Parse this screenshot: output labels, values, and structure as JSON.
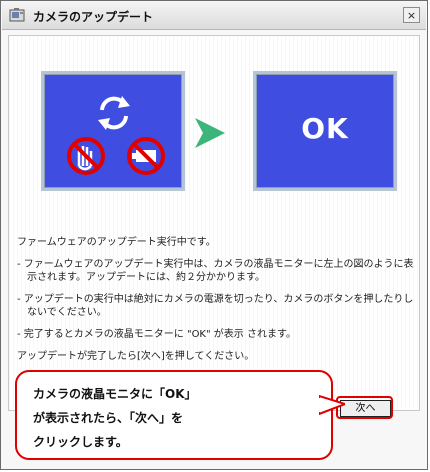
{
  "window": {
    "title": "カメラのアップデート",
    "close_label": "×"
  },
  "illustration": {
    "left_panel_icons": [
      "refresh-icon",
      "no-hand-icon",
      "no-battery-icon"
    ],
    "right_panel_text": "OK",
    "arrow_color": "#3cb57a",
    "panel_color": "#3f4ee0"
  },
  "body": {
    "line1": "ファームウェアのアップデート実行中です。",
    "bullet1": "- ファームウェアのアップデート実行中は、カメラの液晶モニターに左上の図のように表示されます。アップデートには、約２分かかります。",
    "bullet2": "- アップデートの実行中は絶対にカメラの電源を切ったり、カメラのボタンを押したりしないでください。",
    "bullet3": "- 完了するとカメラの液晶モニターに \"OK\" が表示 されます。",
    "line_last": "アップデートが完了したら[次へ]を押してください。"
  },
  "buttons": {
    "next_label": "次へ"
  },
  "callout": {
    "line1": "カメラの液晶モニタに「OK」",
    "line2": "が表示されたら、「次へ」を",
    "line3": "クリックします。",
    "color": "#e00000"
  }
}
